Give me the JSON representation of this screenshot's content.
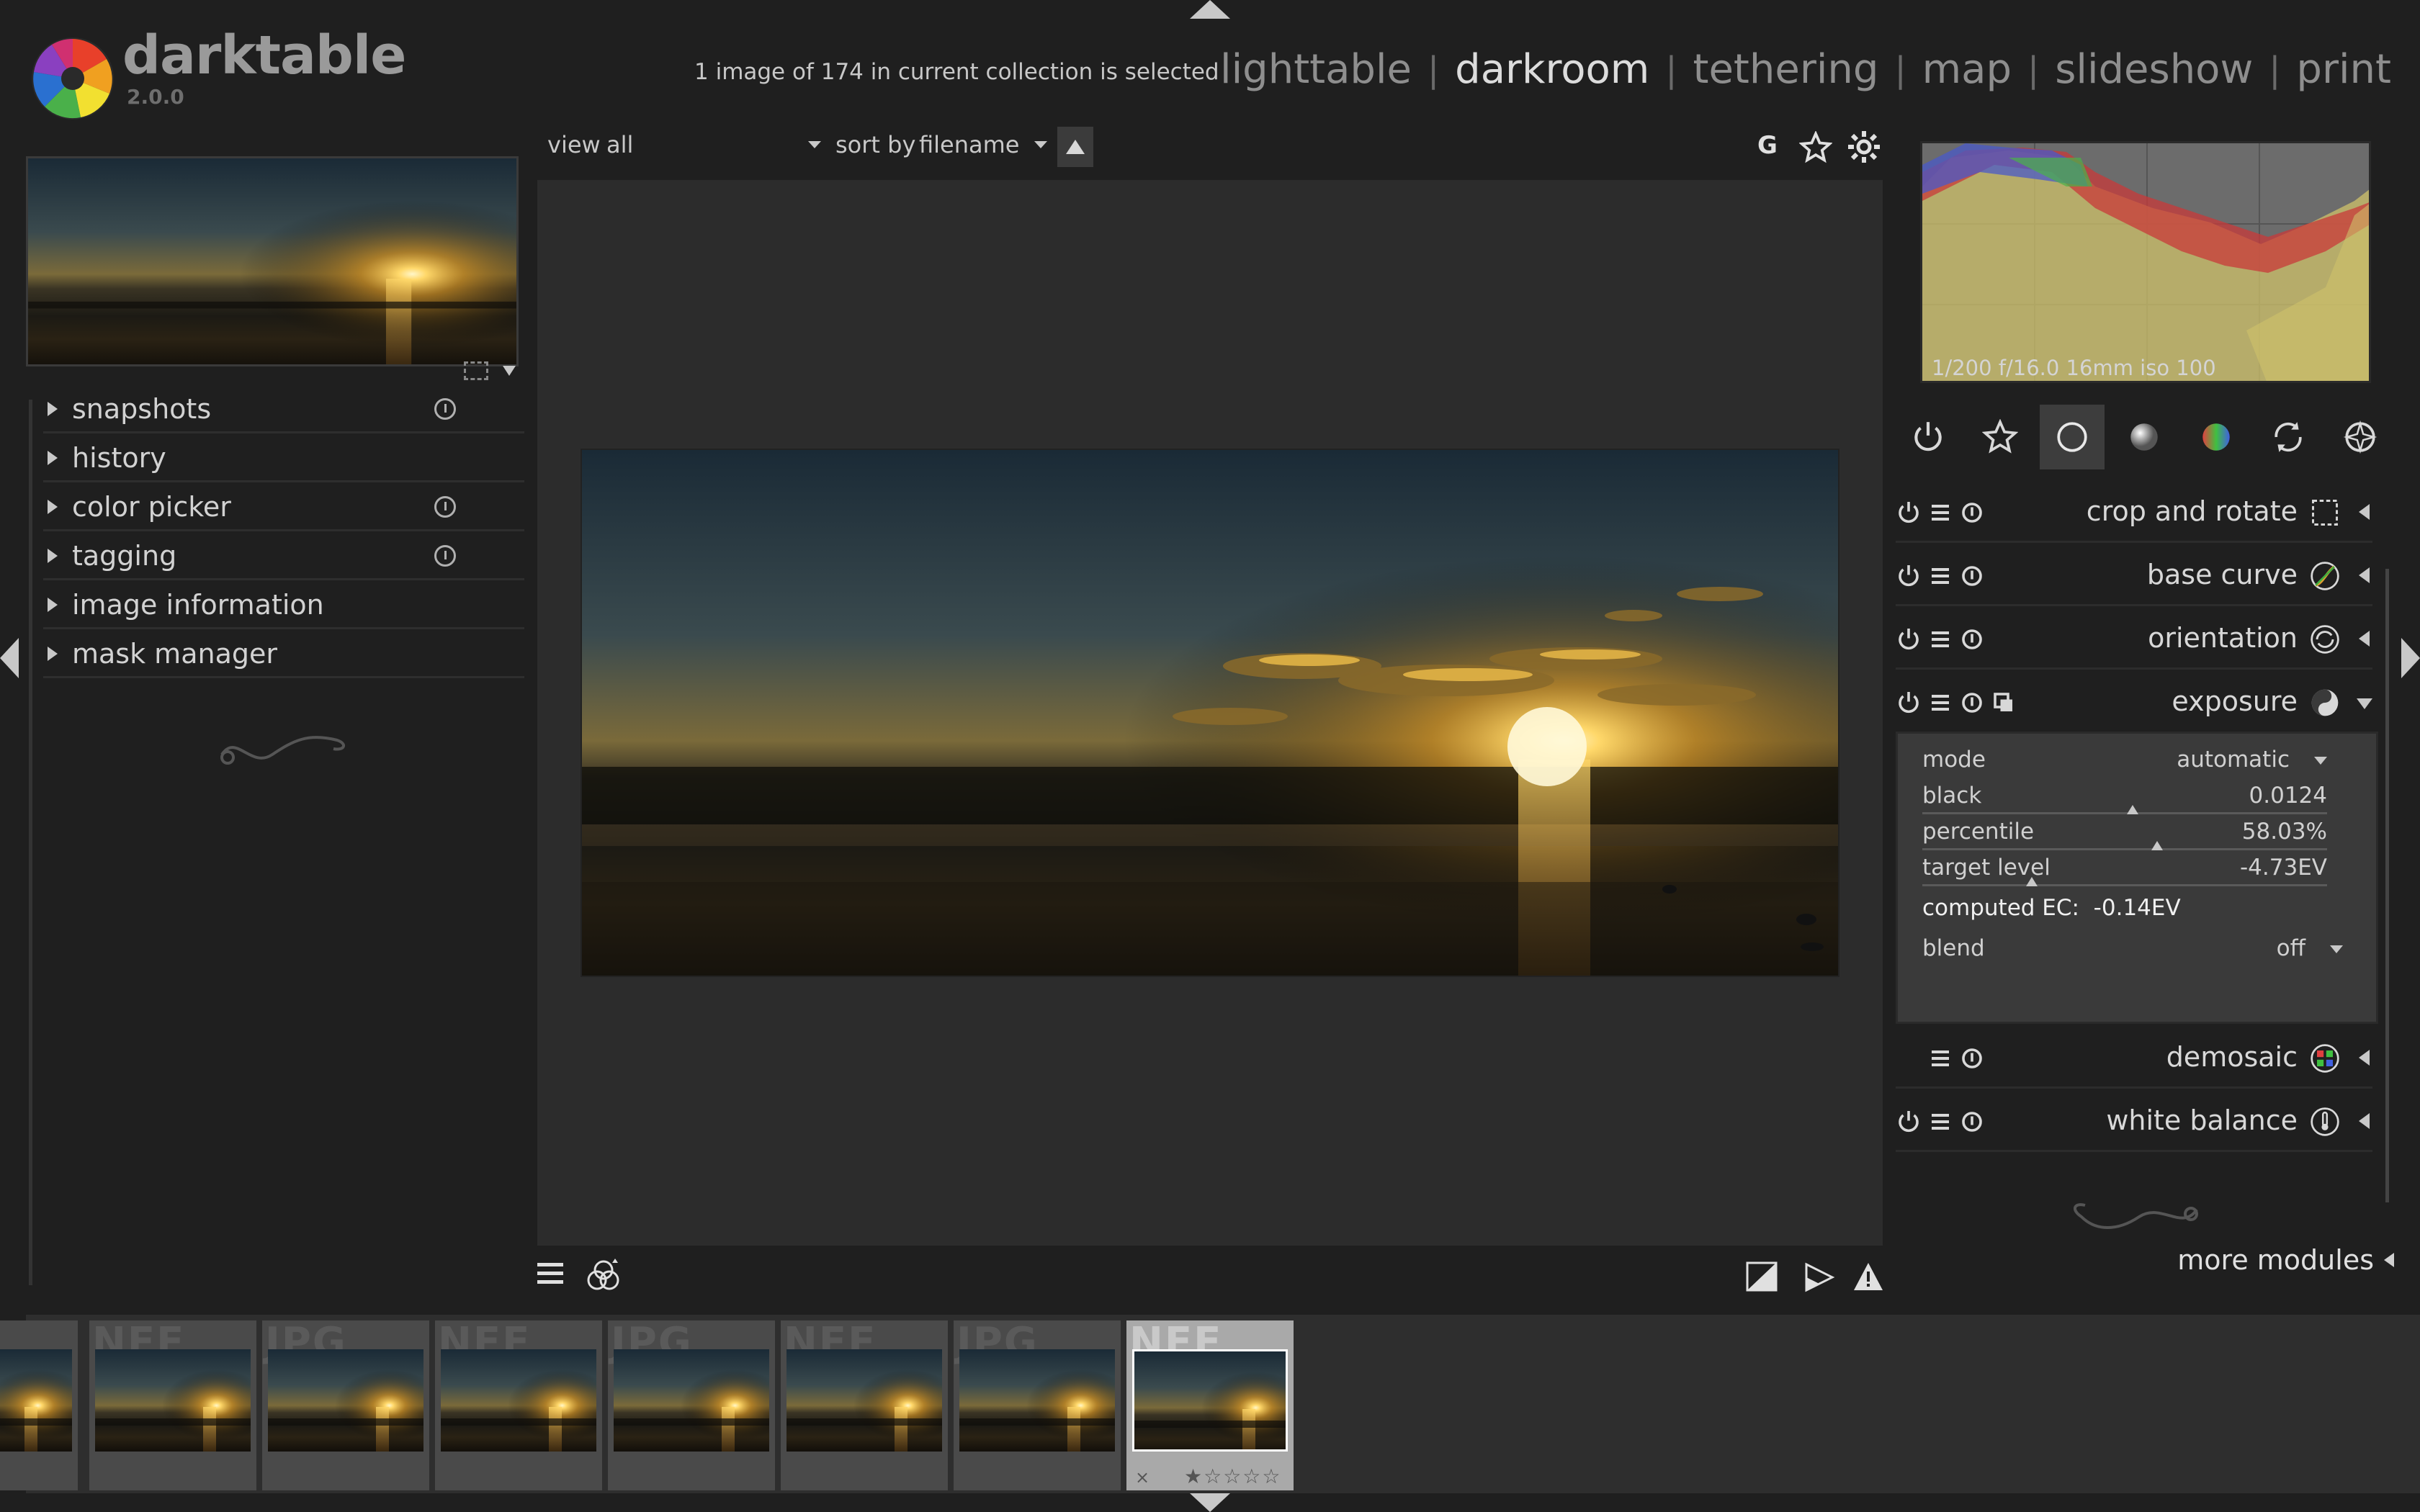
{
  "app": {
    "name": "darktable",
    "version": "2.0.0"
  },
  "header": {
    "selection_status": "1 image of 174 in current collection is selected",
    "views": [
      {
        "label": "lighttable",
        "active": false
      },
      {
        "label": "darkroom",
        "active": true
      },
      {
        "label": "tethering",
        "active": false
      },
      {
        "label": "map",
        "active": false
      },
      {
        "label": "slideshow",
        "active": false
      },
      {
        "label": "print",
        "active": false
      }
    ],
    "separator": "|"
  },
  "toolbar_top": {
    "view_label": "view",
    "view_value": "all",
    "sort_label": "sort by",
    "sort_value": "filename",
    "group_label": "G",
    "icons": [
      "grouping-icon",
      "star-icon",
      "gear-icon"
    ]
  },
  "left_panel": {
    "modules": [
      {
        "label": "snapshots",
        "has_reset": true
      },
      {
        "label": "history",
        "has_reset": false
      },
      {
        "label": "color picker",
        "has_reset": true
      },
      {
        "label": "tagging",
        "has_reset": true
      },
      {
        "label": "image information",
        "has_reset": false
      },
      {
        "label": "mask manager",
        "has_reset": false
      }
    ]
  },
  "histogram": {
    "exif": "1/200 f/16.0 16mm iso 100"
  },
  "module_groups": [
    "power-icon",
    "favorites-icon",
    "basic-group-icon",
    "tone-group-icon",
    "color-group-icon",
    "correct-group-icon",
    "effect-group-icon"
  ],
  "right_modules": {
    "crop": {
      "label": "crop and rotate"
    },
    "basecurve": {
      "label": "base curve"
    },
    "orientation": {
      "label": "orientation"
    },
    "exposure": {
      "label": "exposure",
      "mode_label": "mode",
      "mode_value": "automatic",
      "black_label": "black",
      "black_value": "0.0124",
      "black_level": 0.52,
      "percentile_label": "percentile",
      "percentile_value": "58.03%",
      "percentile_level": 0.58,
      "target_label": "target level",
      "target_value": "-4.73EV",
      "target_level": 0.27,
      "computed_ec": "computed EC:  -0.14EV",
      "blend_label": "blend",
      "blend_value": "off"
    },
    "demosaic": {
      "label": "demosaic"
    },
    "whitebalance": {
      "label": "white balance"
    },
    "more_modules": "more modules"
  },
  "filmstrip": {
    "thumbs": [
      {
        "ext": "",
        "current": false
      },
      {
        "ext": "NEF",
        "current": false
      },
      {
        "ext": "JPG",
        "current": false
      },
      {
        "ext": "NEF",
        "current": false
      },
      {
        "ext": "JPG",
        "current": false
      },
      {
        "ext": "NEF",
        "current": false
      },
      {
        "ext": "JPG",
        "current": false
      },
      {
        "ext": "NEF",
        "current": true
      }
    ],
    "reject_mark": "×",
    "rating_stars": "★☆☆☆☆"
  },
  "colors": {
    "background": "#1f1f1f",
    "center": "#2c2c2c",
    "accent_text": "#dcdcdc"
  }
}
